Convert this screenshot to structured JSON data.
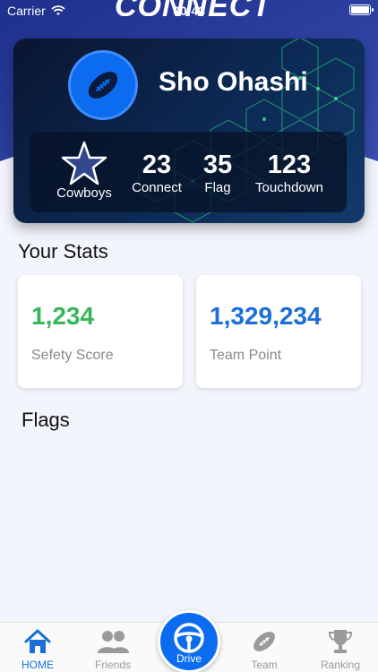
{
  "status_bar": {
    "carrier": "Carrier",
    "time": "00:43"
  },
  "app": {
    "logo": "CONNECT"
  },
  "profile": {
    "name": "Sho Ohashi",
    "avatar_icon": "football-icon",
    "team": "Cowboys",
    "stats": [
      {
        "value": "23",
        "label": "Connect"
      },
      {
        "value": "35",
        "label": "Flag"
      },
      {
        "value": "123",
        "label": "Touchdown"
      }
    ]
  },
  "your_stats": {
    "title": "Your Stats",
    "cards": [
      {
        "value": "1,234",
        "caption": "Sefety Score",
        "color": "#34b75a"
      },
      {
        "value": "1,329,234",
        "caption": "Team Point",
        "color": "#1a6fd8"
      }
    ]
  },
  "flags": {
    "title": "Flags"
  },
  "tab_bar": {
    "items": [
      {
        "label": "HOME",
        "icon": "home-icon",
        "active": true
      },
      {
        "label": "Friends",
        "icon": "friends-icon",
        "active": false
      },
      {
        "label": "Drive",
        "icon": "steering-wheel-icon",
        "active": false
      },
      {
        "label": "Team",
        "icon": "football-icon",
        "active": false
      },
      {
        "label": "Ranking",
        "icon": "trophy-icon",
        "active": false
      }
    ]
  },
  "colors": {
    "primary": "#0c6cf0",
    "header": "#2b3f9e",
    "background": "#f3f5fc"
  }
}
